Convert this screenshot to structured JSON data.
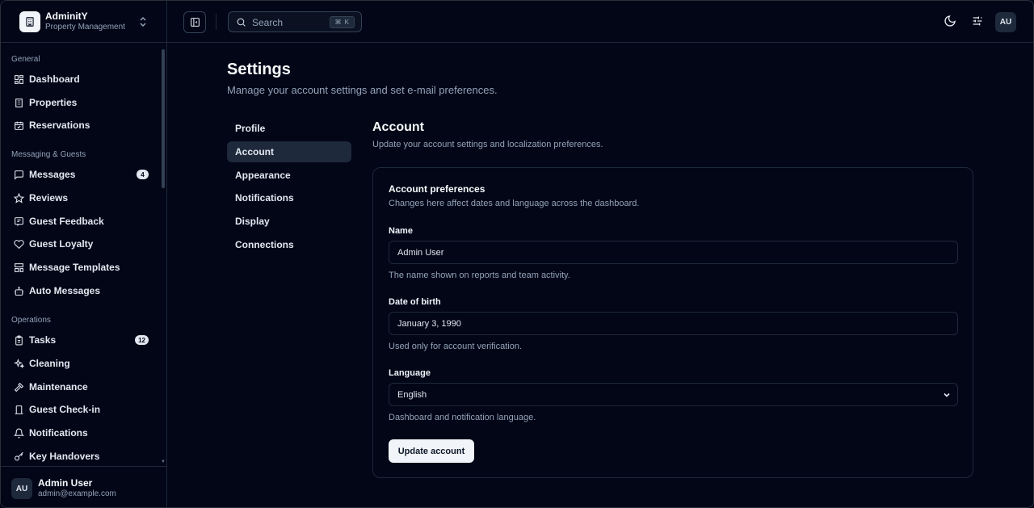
{
  "brand": {
    "name": "AdminitY",
    "subtitle": "Property Management"
  },
  "sidebar": {
    "groups": [
      {
        "label": "General"
      },
      {
        "label": "Messaging & Guests"
      },
      {
        "label": "Operations"
      }
    ],
    "items": [
      {
        "label": "Dashboard",
        "icon": "grid-icon"
      },
      {
        "label": "Properties",
        "icon": "building-icon"
      },
      {
        "label": "Reservations",
        "icon": "calendar-check-icon"
      },
      {
        "label": "Messages",
        "icon": "message-icon",
        "badge": "4"
      },
      {
        "label": "Reviews",
        "icon": "star-icon"
      },
      {
        "label": "Guest Feedback",
        "icon": "feedback-icon"
      },
      {
        "label": "Guest Loyalty",
        "icon": "heart-icon"
      },
      {
        "label": "Message Templates",
        "icon": "template-icon"
      },
      {
        "label": "Auto Messages",
        "icon": "bot-icon"
      },
      {
        "label": "Tasks",
        "icon": "clipboard-icon",
        "badge": "12"
      },
      {
        "label": "Cleaning",
        "icon": "sparkles-icon"
      },
      {
        "label": "Maintenance",
        "icon": "hammer-icon"
      },
      {
        "label": "Guest Check-in",
        "icon": "door-icon"
      },
      {
        "label": "Notifications",
        "icon": "bell-icon"
      },
      {
        "label": "Key Handovers",
        "icon": "key-icon"
      }
    ]
  },
  "user": {
    "initials": "AU",
    "name": "Admin User",
    "email": "admin@example.com"
  },
  "topbar": {
    "search_placeholder": "Search",
    "search_shortcut": "⌘ K",
    "avatar_initials": "AU"
  },
  "page": {
    "title": "Settings",
    "description": "Manage your account settings and set e-mail preferences."
  },
  "settings_nav": [
    {
      "label": "Profile"
    },
    {
      "label": "Account",
      "active": true
    },
    {
      "label": "Appearance"
    },
    {
      "label": "Notifications"
    },
    {
      "label": "Display"
    },
    {
      "label": "Connections"
    }
  ],
  "section": {
    "title": "Account",
    "description": "Update your account settings and localization preferences."
  },
  "card": {
    "title": "Account preferences",
    "description": "Changes here affect dates and language across the dashboard.",
    "fields": {
      "name": {
        "label": "Name",
        "value": "Admin User",
        "help": "The name shown on reports and team activity."
      },
      "dob": {
        "label": "Date of birth",
        "value": "January 3, 1990",
        "help": "Used only for account verification."
      },
      "language": {
        "label": "Language",
        "value": "English",
        "help": "Dashboard and notification language."
      }
    },
    "submit_label": "Update account"
  }
}
